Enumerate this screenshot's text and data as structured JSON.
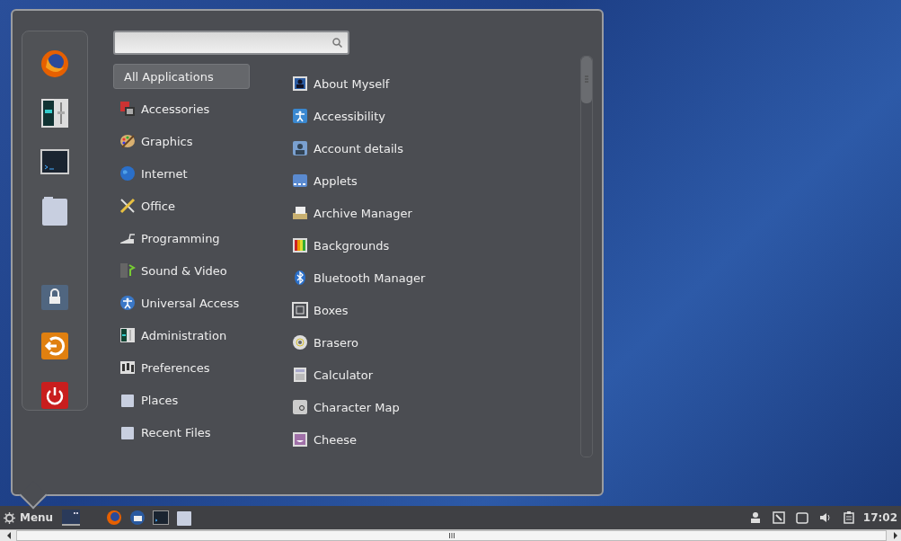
{
  "menu": {
    "categories": [
      {
        "label": "All Applications",
        "selected": true
      },
      {
        "label": "Accessories",
        "selected": false
      },
      {
        "label": "Graphics",
        "selected": false
      },
      {
        "label": "Internet",
        "selected": false
      },
      {
        "label": "Office",
        "selected": false
      },
      {
        "label": "Programming",
        "selected": false
      },
      {
        "label": "Sound & Video",
        "selected": false
      },
      {
        "label": "Universal Access",
        "selected": false
      },
      {
        "label": "Administration",
        "selected": false
      },
      {
        "label": "Preferences",
        "selected": false
      },
      {
        "label": "Places",
        "selected": false
      },
      {
        "label": "Recent Files",
        "selected": false
      }
    ],
    "apps": [
      {
        "label": "About Myself"
      },
      {
        "label": "Accessibility"
      },
      {
        "label": "Account details"
      },
      {
        "label": "Applets"
      },
      {
        "label": "Archive Manager"
      },
      {
        "label": "Backgrounds"
      },
      {
        "label": "Bluetooth Manager"
      },
      {
        "label": "Boxes"
      },
      {
        "label": "Brasero"
      },
      {
        "label": "Calculator"
      },
      {
        "label": "Character Map"
      },
      {
        "label": "Cheese"
      }
    ]
  },
  "taskbar": {
    "menu_label": "Menu",
    "clock": "17:02"
  }
}
